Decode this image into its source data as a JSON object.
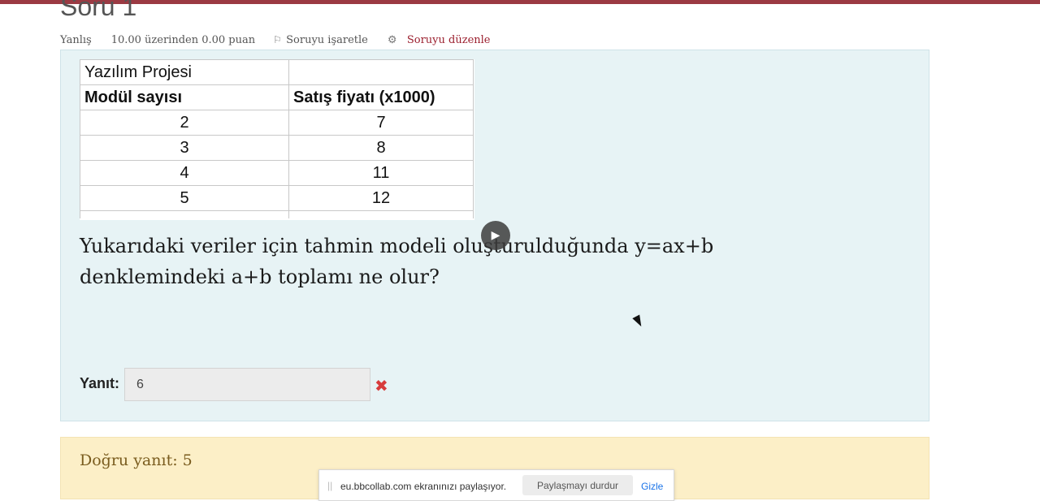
{
  "question": {
    "title": "Soru 1",
    "status": "Yanlış",
    "grade": "10.00 üzerinden 0.00 puan",
    "flag_label": "Soruyu işaretle",
    "edit_label": "Soruyu düzenle",
    "text": "Yukarıdaki veriler için tahmin modeli oluşturulduğunda y=ax+b denklemindeki a+b toplamı ne olur?"
  },
  "table": {
    "title": "Yazılım Projesi",
    "headers": [
      "Modül sayısı",
      "Satış fiyatı (x1000)"
    ],
    "rows": [
      [
        "2",
        "7"
      ],
      [
        "3",
        "8"
      ],
      [
        "4",
        "11"
      ],
      [
        "5",
        "12"
      ]
    ]
  },
  "answer": {
    "label": "Yanıt:",
    "value": "6",
    "result_icon": "cross-icon"
  },
  "feedback": {
    "correct_answer": "Doğru yanıt: 5"
  },
  "share_bar": {
    "message": "eu.bbcollab.com ekranınızı paylaşıyor.",
    "stop_label": "Paylaşmayı durdur",
    "hide_label": "Gizle"
  },
  "colors": {
    "accent": "#9b3a43",
    "content_bg": "#e7f3f5",
    "feedback_bg": "#fcefc7",
    "wrong": "#d73c3c",
    "link_blue": "#1a73e8"
  }
}
